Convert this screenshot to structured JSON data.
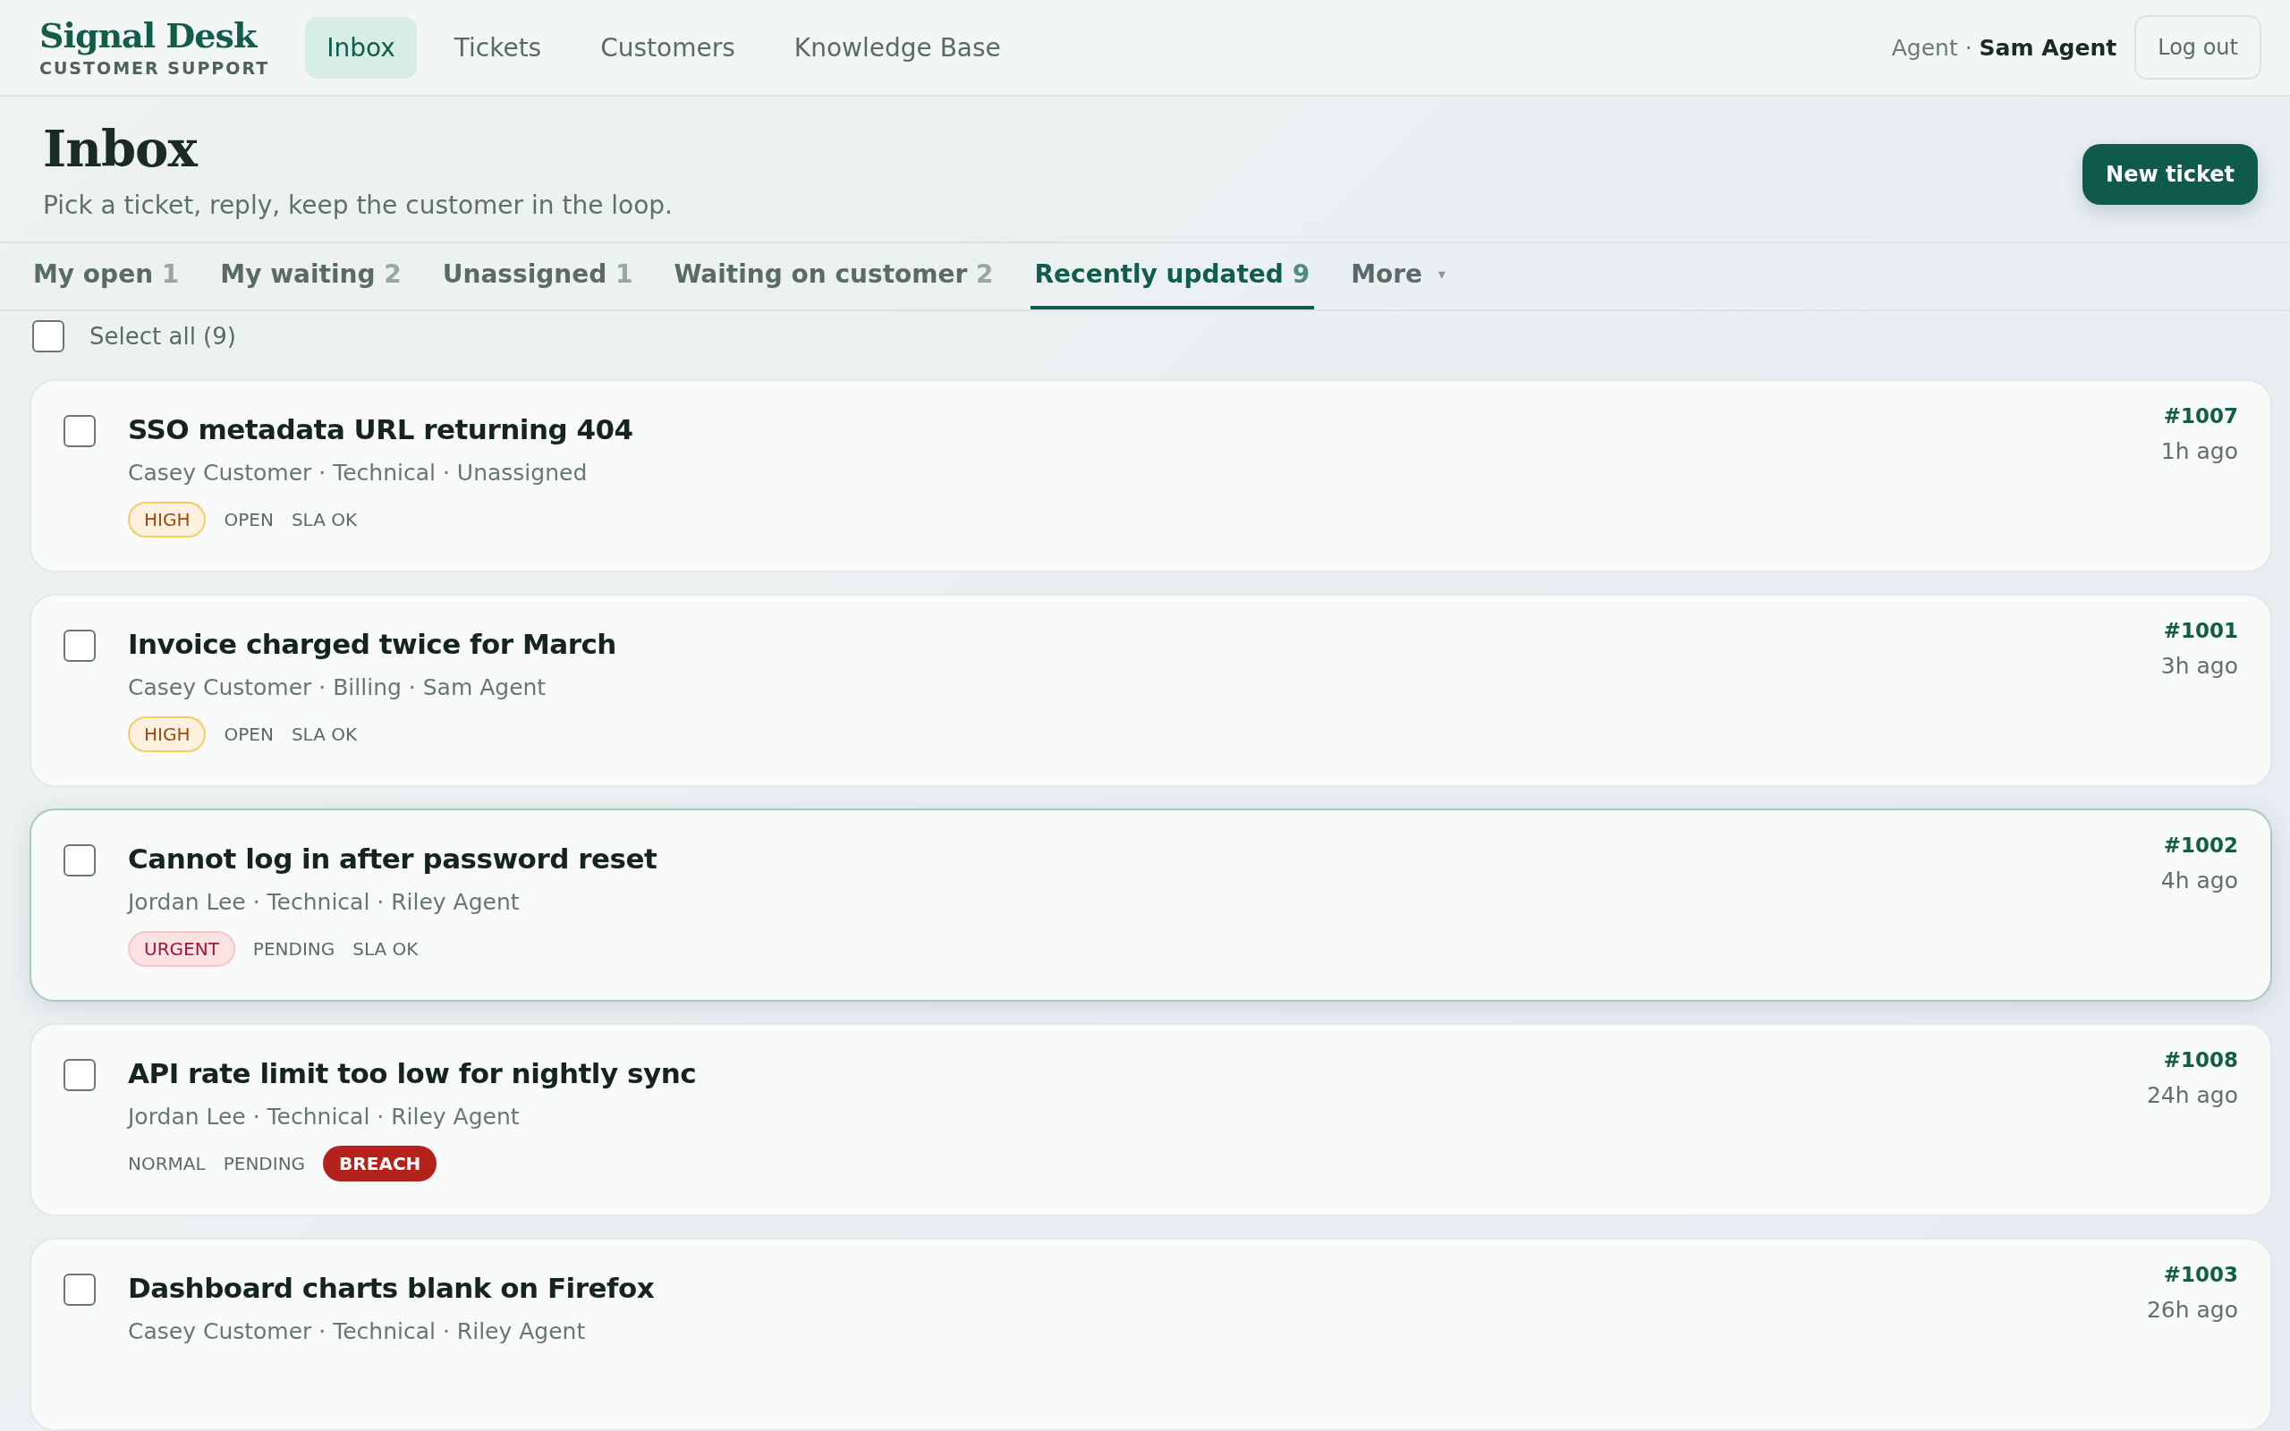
{
  "brand": {
    "name": "Signal Desk",
    "tagline": "CUSTOMER SUPPORT"
  },
  "nav": [
    {
      "label": "Inbox",
      "selected": true
    },
    {
      "label": "Tickets",
      "selected": false
    },
    {
      "label": "Customers",
      "selected": false
    },
    {
      "label": "Knowledge Base",
      "selected": false
    }
  ],
  "user": {
    "role": "Agent",
    "separator": "·",
    "name": "Sam Agent"
  },
  "logout": "Log out",
  "page": {
    "title": "Inbox",
    "subtitle": "Pick a ticket, reply, keep the customer in the loop.",
    "new_button": "New ticket"
  },
  "tabs": [
    {
      "label": "My open",
      "count": "1",
      "selected": false
    },
    {
      "label": "My waiting",
      "count": "2",
      "selected": false
    },
    {
      "label": "Unassigned",
      "count": "1",
      "selected": false
    },
    {
      "label": "Waiting on customer",
      "count": "2",
      "selected": false
    },
    {
      "label": "Recently updated",
      "count": "9",
      "selected": true
    }
  ],
  "more": {
    "label": "More",
    "caret": "▾"
  },
  "select_all": {
    "label": "Select all (9)",
    "checked": false
  },
  "tickets": [
    {
      "title": "SSO metadata URL returning 404",
      "meta": "Casey Customer · Technical · Unassigned",
      "id": "#1007",
      "time": "1h ago",
      "checked": false,
      "highlighted": false,
      "tags": [
        {
          "text": "HIGH",
          "kind": "high"
        },
        {
          "text": "OPEN",
          "kind": "plain"
        },
        {
          "text": "SLA OK",
          "kind": "plain"
        }
      ]
    },
    {
      "title": "Invoice charged twice for March",
      "meta": "Casey Customer · Billing · Sam Agent",
      "id": "#1001",
      "time": "3h ago",
      "checked": false,
      "highlighted": false,
      "tags": [
        {
          "text": "HIGH",
          "kind": "high"
        },
        {
          "text": "OPEN",
          "kind": "plain"
        },
        {
          "text": "SLA OK",
          "kind": "plain"
        }
      ]
    },
    {
      "title": "Cannot log in after password reset",
      "meta": "Jordan Lee · Technical · Riley Agent",
      "id": "#1002",
      "time": "4h ago",
      "checked": false,
      "highlighted": true,
      "tags": [
        {
          "text": "URGENT",
          "kind": "urgent"
        },
        {
          "text": "PENDING",
          "kind": "plain"
        },
        {
          "text": "SLA OK",
          "kind": "plain"
        }
      ]
    },
    {
      "title": "API rate limit too low for nightly sync",
      "meta": "Jordan Lee · Technical · Riley Agent",
      "id": "#1008",
      "time": "24h ago",
      "checked": false,
      "highlighted": false,
      "tags": [
        {
          "text": "NORMAL",
          "kind": "plain"
        },
        {
          "text": "PENDING",
          "kind": "plain"
        },
        {
          "text": "BREACH",
          "kind": "breach"
        }
      ]
    },
    {
      "title": "Dashboard charts blank on Firefox",
      "meta": "Casey Customer · Technical · Riley Agent",
      "id": "#1003",
      "time": "26h ago",
      "checked": false,
      "highlighted": false
    }
  ]
}
